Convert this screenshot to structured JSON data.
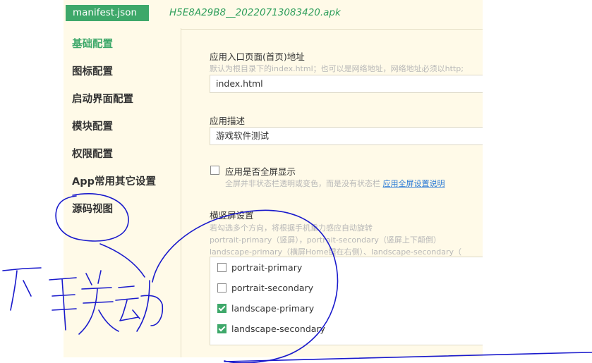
{
  "tabs": {
    "active_tab": "manifest.json",
    "filename": "H5E8A29B8__20220713083420.apk"
  },
  "sidebar": {
    "items": [
      {
        "label": "基础配置",
        "active": true
      },
      {
        "label": "图标配置",
        "active": false
      },
      {
        "label": "启动界面配置",
        "active": false
      },
      {
        "label": "模块配置",
        "active": false
      },
      {
        "label": "权限配置",
        "active": false
      },
      {
        "label": "App常用其它设置",
        "active": false
      },
      {
        "label": "源码视图",
        "active": false
      }
    ]
  },
  "form": {
    "entry": {
      "label": "应用入口页面(首页)地址",
      "hint": "默认为根目录下的index.html；也可以是网络地址，网络地址必须以http;",
      "value": "index.html"
    },
    "description": {
      "label": "应用描述",
      "value": "游戏软件测试"
    },
    "fullscreen": {
      "label": "应用是否全屏显示",
      "checked": false,
      "hint": "全屏并非状态栏透明或变色，而是没有状态栏",
      "link": "应用全屏设置说明"
    },
    "orientation": {
      "label": "横竖屏设置",
      "hint_lines": [
        "若勾选多个方向，将根据手机重力感应自动旋转",
        "portrait-primary（竖屏），portrait-secondary（竖屏上下颠倒）",
        "landscape-primary（横屏Home键在右侧）、landscape-secondary（"
      ],
      "options": [
        {
          "label": "portrait-primary",
          "checked": false
        },
        {
          "label": "portrait-secondary",
          "checked": false
        },
        {
          "label": "landscape-primary",
          "checked": true
        },
        {
          "label": "landscape-secondary",
          "checked": true
        }
      ]
    }
  },
  "colors": {
    "accent": "#3ea86a",
    "panel_bg": "#fffae8",
    "ink": "#1a1acc",
    "link": "#2a7ad6"
  }
}
